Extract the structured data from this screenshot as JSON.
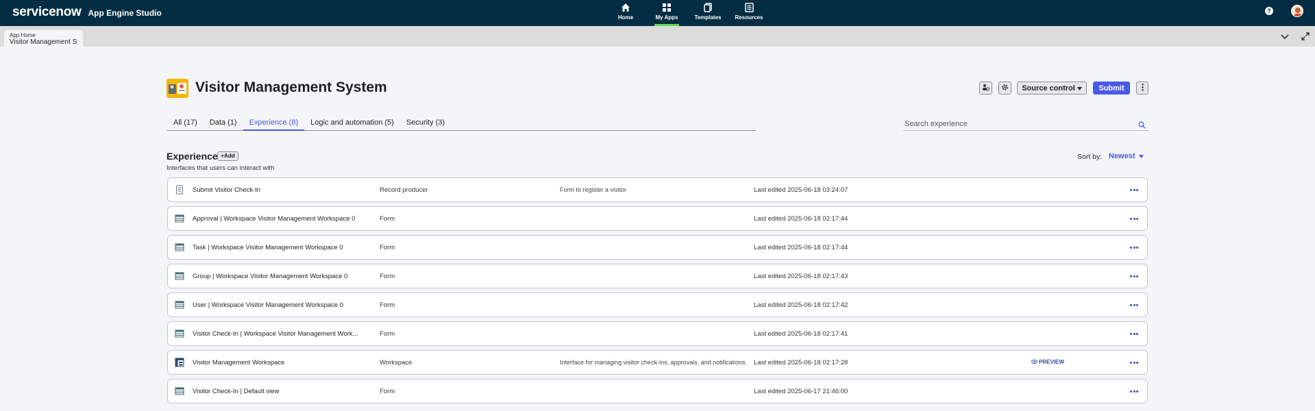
{
  "topbar": {
    "logo": "servicenow",
    "app_name": "App Engine Studio",
    "nav": [
      {
        "label": "Home",
        "icon": "home-icon"
      },
      {
        "label": "My Apps",
        "icon": "grid-icon",
        "active": true
      },
      {
        "label": "Templates",
        "icon": "templates-icon"
      },
      {
        "label": "Resources",
        "icon": "resources-icon"
      }
    ],
    "help": "?",
    "colors": {
      "bar": "#032d42",
      "active_indicator": "#62d84e"
    }
  },
  "tabstrip": {
    "tab_line1": "App Home",
    "tab_line2": "Visitor Management Sy..."
  },
  "header": {
    "title": "Visitor Management System",
    "source_control": "Source control",
    "submit": "Submit",
    "accent": "#4a5ae8"
  },
  "filters": {
    "tabs": [
      {
        "label": "All (17)"
      },
      {
        "label": "Data (1)"
      },
      {
        "label": "Experience (8)",
        "active": true
      },
      {
        "label": "Logic and automation (5)"
      },
      {
        "label": "Security (3)"
      }
    ],
    "search_placeholder": "Search experience"
  },
  "section": {
    "title": "Experience",
    "add_label": "+Add",
    "subtitle": "Interfaces that users can interact with",
    "sort_label": "Sort by:",
    "sort_value": "Newest"
  },
  "rows": [
    {
      "name": "Submit Visitor Check-In",
      "type": "Record producer",
      "desc": "Form to register a visitor",
      "edited": "Last edited 2025-06-18 03:24:07",
      "icon": "document-icon",
      "preview": ""
    },
    {
      "name": "Approval | Workspace Visitor Management Workspace 0",
      "type": "Form",
      "desc": "",
      "edited": "Last edited 2025-06-18 02:17:44",
      "icon": "table-icon",
      "preview": ""
    },
    {
      "name": "Task | Workspace Visitor Management Workspace 0",
      "type": "Form",
      "desc": "",
      "edited": "Last edited 2025-06-18 02:17:44",
      "icon": "table-icon",
      "preview": ""
    },
    {
      "name": "Group | Workspace Visitor Management Workspace 0",
      "type": "Form",
      "desc": "",
      "edited": "Last edited 2025-06-18 02:17:43",
      "icon": "table-icon",
      "preview": ""
    },
    {
      "name": "User | Workspace Visitor Management Workspace 0",
      "type": "Form",
      "desc": "",
      "edited": "Last edited 2025-06-18 02:17:42",
      "icon": "table-icon",
      "preview": ""
    },
    {
      "name": "Visitor Check-In | Workspace Visitor Management Work...",
      "type": "Form",
      "desc": "",
      "edited": "Last edited 2025-06-18 02:17:41",
      "icon": "table-icon",
      "preview": ""
    },
    {
      "name": "Visitor Management Workspace",
      "type": "Workspace",
      "desc": "Interface for managing visitor check-ins, approvals, and notifications.",
      "edited": "Last edited 2025-06-18 02:17:28",
      "icon": "workspace-icon",
      "preview": "PREVIEW"
    },
    {
      "name": "Visitor Check-In | Default view",
      "type": "Form",
      "desc": "",
      "edited": "Last edited 2025-06-17 21:46:00",
      "icon": "table-icon",
      "preview": ""
    }
  ]
}
